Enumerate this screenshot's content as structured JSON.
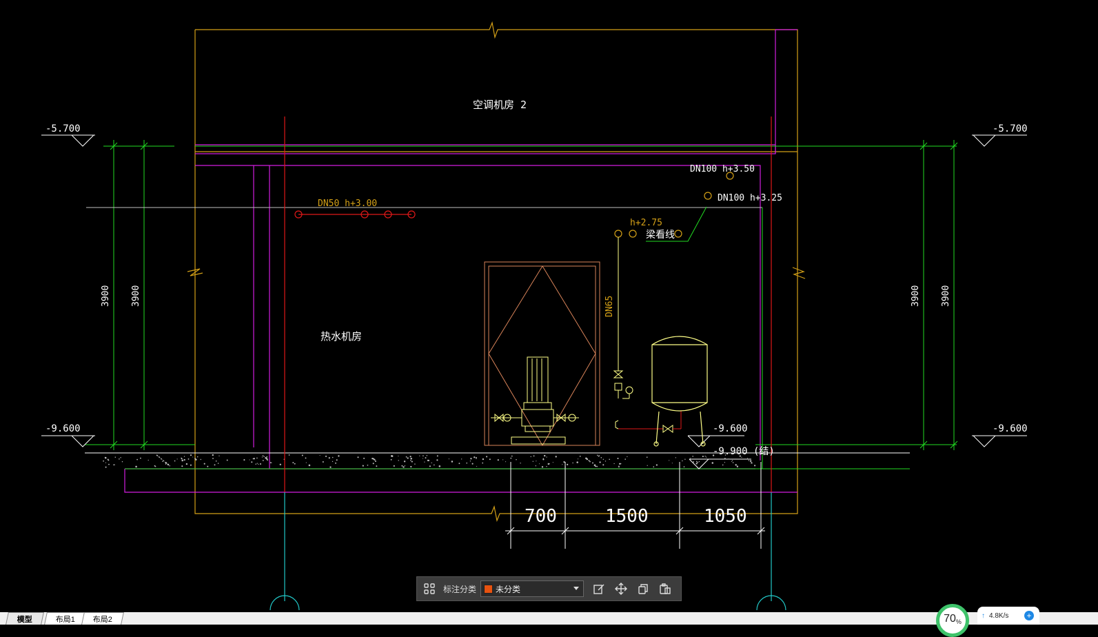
{
  "drawing": {
    "room_top": "空调机房  2",
    "room_main": "热水机房",
    "level_left_top": "-5.700",
    "level_right_top": "-5.700",
    "level_left_bottom": "-9.600",
    "level_right_bottom": "-9.600",
    "level_floor": "-9.600",
    "level_struct": "-9.900  (结)",
    "dim_left_1": "3900",
    "dim_left_2": "3900",
    "dim_right_1": "3900",
    "dim_right_2": "3900",
    "pipe_dn50": "DN50  h+3.00",
    "pipe_dn100_a": "DN100  h+3.50",
    "pipe_dn100_b": "DN100  h+3.25",
    "pipe_h275": "h+2.75",
    "beam_label": "梁看线",
    "pipe_dn65": "DN65",
    "dim_bottom": [
      "700",
      "1500",
      "1050"
    ],
    "colors": {
      "wall": "#d4a017",
      "magenta": "#d21ee0",
      "green": "#22dd22",
      "red": "#e01818",
      "cyan": "#22c8c8",
      "door": "#d9845a",
      "equip": "#ffff88",
      "white": "#ffffff"
    }
  },
  "toolbar": {
    "grid_icon": "grid-icon",
    "category_label": "标注分类",
    "category_value": "未分类",
    "category_color": "#e8520f",
    "tools": [
      "edit-icon",
      "move-icon",
      "copy-icon",
      "paste-icon"
    ]
  },
  "tabs": [
    {
      "label": "模型",
      "active": true
    },
    {
      "label": "布局1",
      "active": false
    },
    {
      "label": "布局2",
      "active": false
    }
  ],
  "status": {
    "percent": "70",
    "percent_unit": "%",
    "upload_speed": "4.8K/s"
  }
}
